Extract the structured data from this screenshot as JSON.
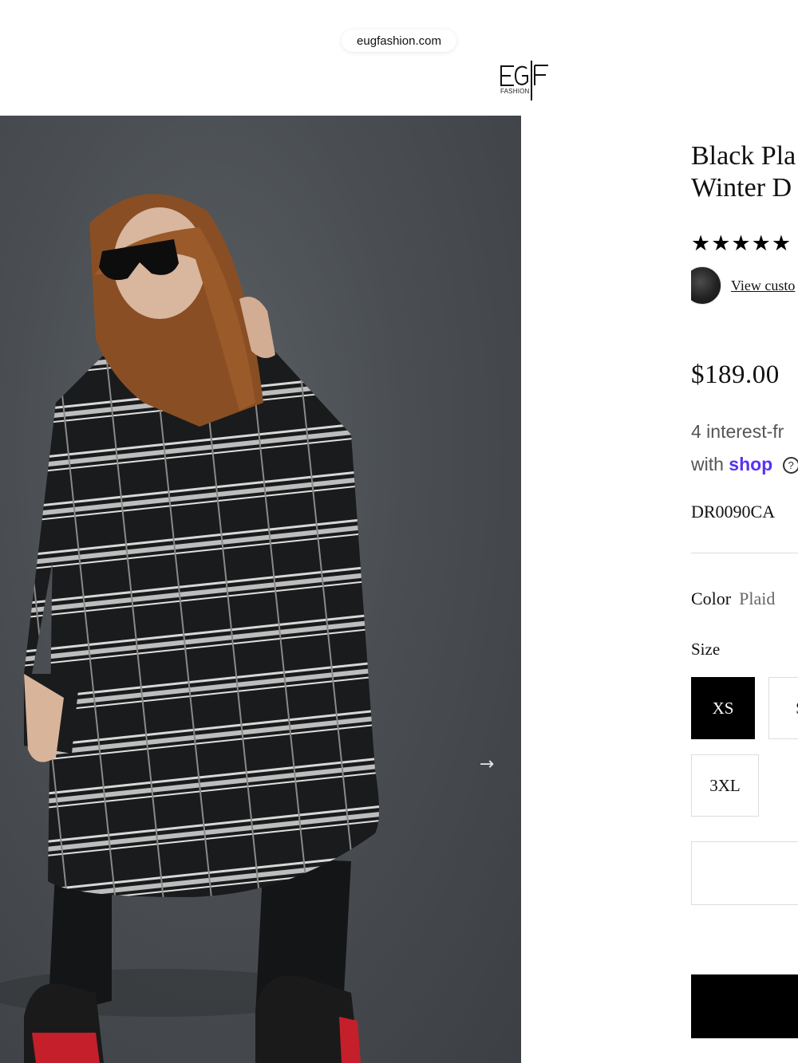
{
  "browser": {
    "url": "eugfashion.com"
  },
  "brand": {
    "logo_text": "EGF",
    "logo_sub": "FASHION"
  },
  "gallery": {
    "image_alt": "Woman in black plaid winter dress with sunglasses",
    "next_icon": "arrow-right-icon"
  },
  "product": {
    "title_line1": "Black Pla",
    "title_line2": "Winter D",
    "stars": "★★★★★",
    "rating": 5,
    "review_link": "View custo",
    "price": "$189.00",
    "installments_line1": "4 interest-fr",
    "installments_line2_prefix": "with",
    "shop_logo": "shop",
    "help_icon": "?",
    "sku": "DR0090CA",
    "color_label": "Color",
    "color_value": "Plaid",
    "size_label": "Size",
    "sizes": [
      "XS",
      "S",
      "3XL"
    ],
    "selected_size": "XS"
  },
  "colors": {
    "accent": "#000000",
    "shop_purple": "#5a31f4",
    "background": "#ffffff"
  }
}
